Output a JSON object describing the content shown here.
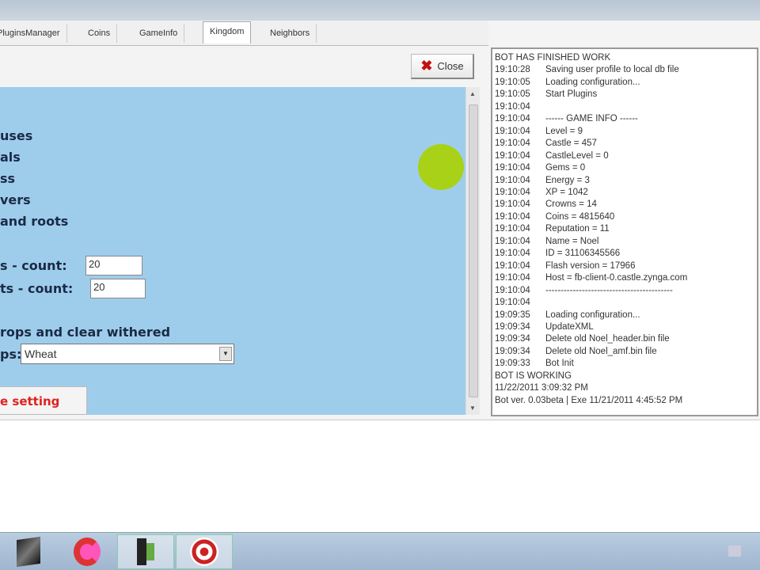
{
  "tabs": [
    {
      "label": "PluginsManager"
    },
    {
      "label": "Coins"
    },
    {
      "label": "GameInfo"
    },
    {
      "label": "Kingdom",
      "active": true
    },
    {
      "label": "Neighbors"
    }
  ],
  "toolbar": {
    "close_label": "Close"
  },
  "settings": {
    "options": [
      "uses",
      "als",
      "ss",
      "vers",
      "and roots"
    ],
    "count_rows": [
      {
        "label": "s  -  count:",
        "value": "20"
      },
      {
        "label": "ts  -  count:",
        "value": "20"
      }
    ],
    "harvest_label": "rops and clear withered",
    "crop_label": "ps:",
    "crop_value": "Wheat",
    "save_label": "e setting"
  },
  "log": [
    {
      "t": "",
      "m": "BOT HAS FINISHED WORK"
    },
    {
      "t": "19:10:28",
      "m": "Saving user profile to local db file"
    },
    {
      "t": "19:10:05",
      "m": "Loading configuration..."
    },
    {
      "t": "19:10:05",
      "m": "Start Plugins"
    },
    {
      "t": "19:10:04",
      "m": ""
    },
    {
      "t": "19:10:04",
      "m": "------  GAME INFO  ------"
    },
    {
      "t": "19:10:04",
      "m": "Level = 9"
    },
    {
      "t": "19:10:04",
      "m": "Castle = 457"
    },
    {
      "t": "19:10:04",
      "m": "CastleLevel = 0"
    },
    {
      "t": "19:10:04",
      "m": "Gems = 0"
    },
    {
      "t": "19:10:04",
      "m": "Energy = 3"
    },
    {
      "t": "19:10:04",
      "m": "XP = 1042"
    },
    {
      "t": "19:10:04",
      "m": "Crowns = 14"
    },
    {
      "t": "19:10:04",
      "m": "Coins = 4815640"
    },
    {
      "t": "19:10:04",
      "m": "Reputation = 11"
    },
    {
      "t": "19:10:04",
      "m": "Name = Noel"
    },
    {
      "t": "19:10:04",
      "m": "ID = 31106345566"
    },
    {
      "t": "19:10:04",
      "m": "Flash version = 17966"
    },
    {
      "t": "19:10:04",
      "m": "Host = fb-client-0.castle.zynga.com"
    },
    {
      "t": "19:10:04",
      "m": "------------------------------------------"
    },
    {
      "t": "19:10:04",
      "m": ""
    },
    {
      "t": "19:09:35",
      "m": "Loading configuration..."
    },
    {
      "t": "19:09:34",
      "m": "UpdateXML"
    },
    {
      "t": "19:09:34",
      "m": "Delete old Noel_header.bin file"
    },
    {
      "t": "19:09:34",
      "m": "Delete old Noel_amf.bin file"
    },
    {
      "t": "19:09:33",
      "m": "Bot Init"
    },
    {
      "t": "",
      "m": "BOT IS WORKING"
    },
    {
      "t": "",
      "m": "11/22/2011 3:09:32 PM"
    },
    {
      "t": "",
      "m": "Bot ver. 0.03beta | Exe 11/21/2011 4:45:52 PM"
    }
  ],
  "taskbar": {
    "icons": [
      "media-app-icon",
      "ccleaner-icon",
      "phone-app-icon",
      "target-app-icon"
    ]
  },
  "colors": {
    "panel_blue": "#9ecdec",
    "save_red": "#e02020",
    "close_red": "#c41010"
  }
}
